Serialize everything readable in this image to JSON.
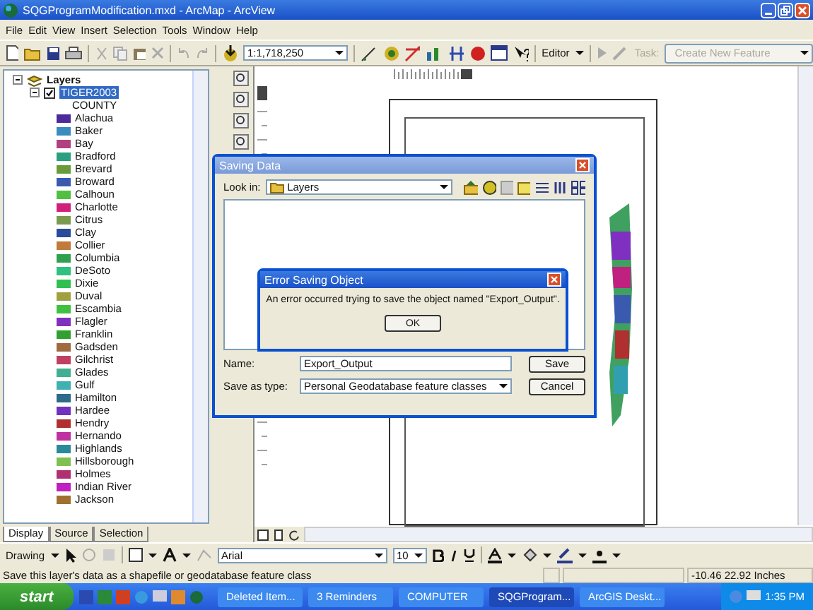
{
  "window": {
    "title": "SQGProgramModification.mxd - ArcMap - ArcView"
  },
  "menu": [
    "File",
    "Edit",
    "View",
    "Insert",
    "Selection",
    "Tools",
    "Window",
    "Help"
  ],
  "toolbar": {
    "scale": "1:1,718,250",
    "editor": "Editor",
    "task_label": "Task:",
    "task": "Create New Feature"
  },
  "toc": {
    "root": "Layers",
    "expanded": true,
    "layer": {
      "name": "TIGER2003",
      "checked": true,
      "selected": true,
      "field": "COUNTY"
    },
    "classes": [
      {
        "label": "Alachua",
        "color": "#4b2a9a"
      },
      {
        "label": "Baker",
        "color": "#3a8cc0"
      },
      {
        "label": "Bay",
        "color": "#b04080"
      },
      {
        "label": "Bradford",
        "color": "#2aa080"
      },
      {
        "label": "Brevard",
        "color": "#6a9a3a"
      },
      {
        "label": "Broward",
        "color": "#3a5ab0"
      },
      {
        "label": "Calhoun",
        "color": "#50c040"
      },
      {
        "label": "Charlotte",
        "color": "#d0207a"
      },
      {
        "label": "Citrus",
        "color": "#7a9a50"
      },
      {
        "label": "Clay",
        "color": "#2a4a9a"
      },
      {
        "label": "Collier",
        "color": "#c07a3a"
      },
      {
        "label": "Columbia",
        "color": "#30a050"
      },
      {
        "label": "DeSoto",
        "color": "#30c080"
      },
      {
        "label": "Dixie",
        "color": "#30c050"
      },
      {
        "label": "Duval",
        "color": "#a0a040"
      },
      {
        "label": "Escambia",
        "color": "#40c040"
      },
      {
        "label": "Flagler",
        "color": "#8030c0"
      },
      {
        "label": "Franklin",
        "color": "#30a030"
      },
      {
        "label": "Gadsden",
        "color": "#a06a40"
      },
      {
        "label": "Gilchrist",
        "color": "#c04060"
      },
      {
        "label": "Glades",
        "color": "#40b090"
      },
      {
        "label": "Gulf",
        "color": "#40b0b0"
      },
      {
        "label": "Hamilton",
        "color": "#2a6a8a"
      },
      {
        "label": "Hardee",
        "color": "#7030c0"
      },
      {
        "label": "Hendry",
        "color": "#b03030"
      },
      {
        "label": "Hernando",
        "color": "#c030a0"
      },
      {
        "label": "Highlands",
        "color": "#2a8a9a"
      },
      {
        "label": "Hillsborough",
        "color": "#80c050"
      },
      {
        "label": "Holmes",
        "color": "#b03070"
      },
      {
        "label": "Indian River",
        "color": "#c020c0"
      },
      {
        "label": "Jackson",
        "color": "#a07030"
      }
    ],
    "tabs": [
      {
        "label": "Display",
        "selected": true
      },
      {
        "label": "Source",
        "selected": false
      },
      {
        "label": "Selection",
        "selected": false
      }
    ]
  },
  "saving_dialog": {
    "title": "Saving Data",
    "look_in_label": "Look in:",
    "look_in": "Layers",
    "name_label": "Name:",
    "name": "Export_Output",
    "type_label": "Save as type:",
    "type": "Personal Geodatabase feature classes",
    "buttons": [
      "Save",
      "Cancel"
    ]
  },
  "error_dialog": {
    "title": "Error Saving Object",
    "message": "An error occurred trying to save the object named \"Export_Output\".",
    "button": "OK"
  },
  "drawing_toolbar": {
    "menu": "Drawing",
    "font": "Arial",
    "size": "10"
  },
  "status_bar": {
    "message": "Save this layer's data as a shapefile or geodatabase feature class",
    "coords": "-10.46  22.92 Inches"
  },
  "taskbar": {
    "start": "start",
    "tasks": [
      {
        "label": "Deleted Item...",
        "selected": false
      },
      {
        "label": "3 Reminders",
        "selected": false
      },
      {
        "label": "COMPUTER",
        "selected": false
      },
      {
        "label": "SQGProgram...",
        "selected": true
      },
      {
        "label": "ArcGIS Deskt...",
        "selected": false
      }
    ],
    "clock": "1:35 PM"
  }
}
